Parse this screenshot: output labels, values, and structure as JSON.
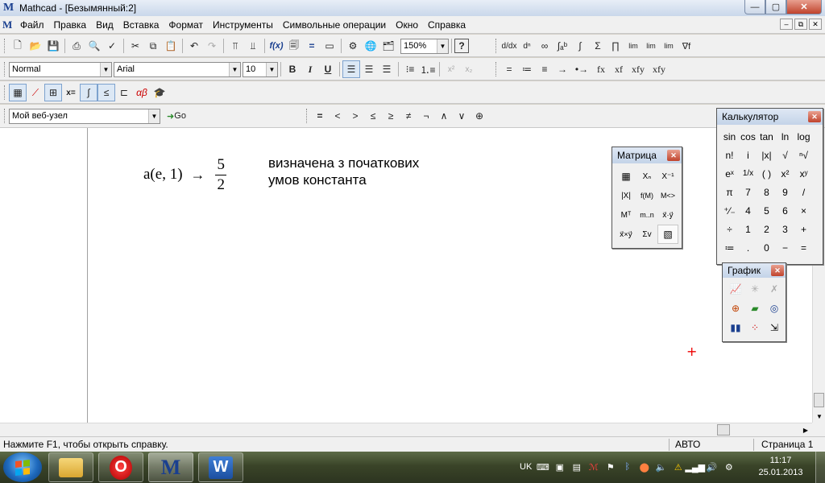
{
  "window": {
    "title": "Mathcad - [Безымянный:2]",
    "minimize": "—",
    "maximize": "▢",
    "close": "✕"
  },
  "menu": {
    "items": [
      "Файл",
      "Правка",
      "Вид",
      "Вставка",
      "Формат",
      "Инструменты",
      "Символьные операции",
      "Окно",
      "Справка"
    ],
    "mdi_min": "–",
    "mdi_restore": "⧉",
    "mdi_close": "✕"
  },
  "toolbar_standard": {
    "zoom": "150%",
    "zoom_arrow": "▼",
    "help": "?",
    "math_symbols": [
      "∫",
      "Σ",
      "∏",
      "lim",
      "lim",
      "lim",
      "∇f"
    ]
  },
  "toolbar_format": {
    "style": "Normal",
    "font": "Arial",
    "size": "10",
    "bold": "B",
    "italic": "I",
    "underline": "U",
    "superscript": "x²",
    "subscript": "x₂",
    "symbolic_ops": [
      "=",
      "≔",
      "≡",
      "→",
      "•→",
      "fx",
      "xf",
      "xfy",
      "xfy"
    ]
  },
  "toolbar_web": {
    "site": "Мой веб-узел",
    "go": "Go"
  },
  "toolbar_boolean": {
    "ops": [
      "=",
      "<",
      ">",
      "≤",
      "≥",
      "≠",
      "¬",
      "∧",
      "∨",
      "⊕"
    ]
  },
  "worksheet": {
    "expr_lhs": "a(e, 1)",
    "expr_arrow": "→",
    "frac_num": "5",
    "frac_den": "2",
    "note_line1": "визначена з початкових",
    "note_line2": "умов константа"
  },
  "palette_matrix": {
    "title": "Матрица",
    "cells": [
      "▦",
      "Xₙ",
      "X⁻¹",
      "|X|",
      "f(M)",
      "M<>",
      "Mᵀ",
      "m..n",
      "x⃗·y⃗",
      "x⃗×y⃗",
      "Σv",
      "▧"
    ]
  },
  "palette_calc": {
    "title": "Калькулятор",
    "cells": [
      "sin",
      "cos",
      "tan",
      "ln",
      "log",
      "n!",
      "i",
      "|x|",
      "√",
      "ⁿ√",
      "eˣ",
      "1/x",
      "( )",
      "x²",
      "xʸ",
      "π",
      "7",
      "8",
      "9",
      "/",
      "⁺⁄₋",
      "4",
      "5",
      "6",
      "×",
      "÷",
      "1",
      "2",
      "3",
      "+",
      "≔",
      ".",
      "0",
      "−",
      "="
    ]
  },
  "palette_graph": {
    "title": "График"
  },
  "status": {
    "help": "Нажмите F1, чтобы открыть справку.",
    "mode": "АВТО",
    "page": "Страница 1"
  },
  "taskbar": {
    "lang": "UK",
    "time": "11:17",
    "date": "25.01.2013",
    "word_letter": "W",
    "mathcad_letter": "M",
    "opera_letter": "O"
  },
  "colors": {
    "accent": "#1a3f8f",
    "close_red": "#c0432c",
    "crosshair": "#e00000"
  }
}
